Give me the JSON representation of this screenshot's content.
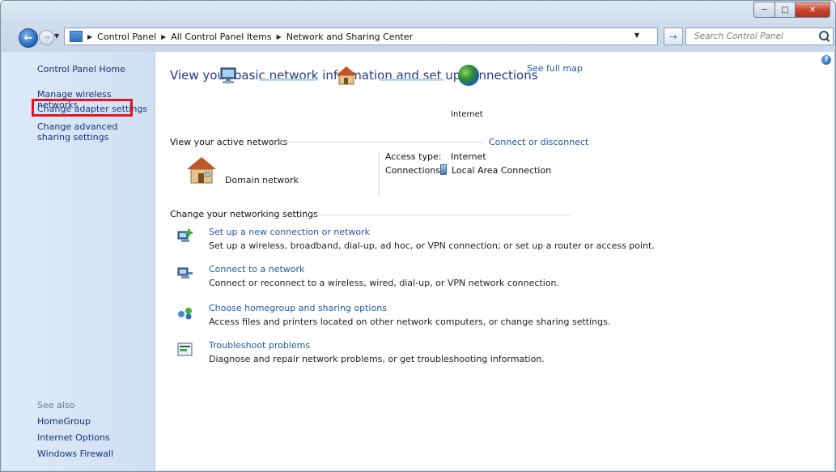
{
  "address_bar": {
    "crumbs": [
      "Control Panel",
      "All Control Panel Items",
      "Network and Sharing Center"
    ],
    "search_placeholder": "Search Control Panel"
  },
  "sidebar": {
    "home": "Control Panel Home",
    "items": [
      "Manage wireless networks",
      "Change adapter settings",
      "Change advanced sharing settings"
    ],
    "see_also_label": "See also",
    "see_also": [
      "HomeGroup",
      "Internet Options",
      "Windows Firewall"
    ]
  },
  "main": {
    "headline": "View your basic network information and set up connections",
    "map": {
      "internet_label": "Internet",
      "full_map_link": "See full map"
    },
    "active_networks": {
      "header": "View your active networks",
      "connect_link": "Connect or disconnect",
      "network_name": "Domain network",
      "access_type_label": "Access type:",
      "access_type_value": "Internet",
      "connections_label": "Connections:",
      "connections_value": "Local Area Connection"
    },
    "settings": {
      "header": "Change your networking settings",
      "tasks": [
        {
          "link": "Set up a new connection or network",
          "desc": "Set up a wireless, broadband, dial-up, ad hoc, or VPN connection; or set up a router or access point."
        },
        {
          "link": "Connect to a network",
          "desc": "Connect or reconnect to a wireless, wired, dial-up, or VPN network connection."
        },
        {
          "link": "Choose homegroup and sharing options",
          "desc": "Access files and printers located on other network computers, or change sharing settings."
        },
        {
          "link": "Troubleshoot problems",
          "desc": "Diagnose and repair network problems, or get troubleshooting information."
        }
      ]
    }
  },
  "colors": {
    "link": "#1e5aa8",
    "highlight_box": "#e3141f",
    "sidebar_bg": "#d4e4f5"
  }
}
